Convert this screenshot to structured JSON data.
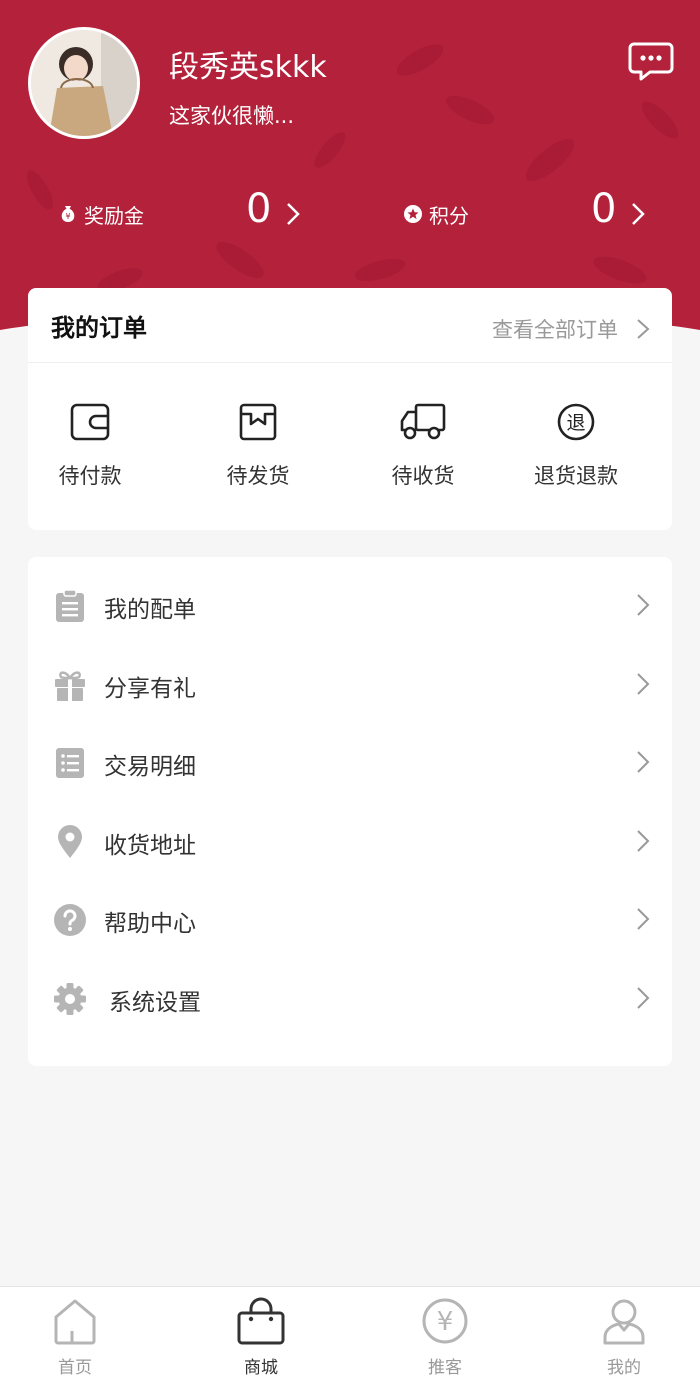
{
  "profile": {
    "username": "段秀英skkk",
    "bio": "这家伙很懒..."
  },
  "stats": {
    "reward_label": "奖励金",
    "reward_value": "0",
    "points_label": "积分",
    "points_value": "0"
  },
  "orders": {
    "title": "我的订单",
    "view_all": "查看全部订单",
    "items": [
      {
        "label": "待付款",
        "icon": "wallet-icon"
      },
      {
        "label": "待发货",
        "icon": "package-icon"
      },
      {
        "label": "待收货",
        "icon": "truck-icon"
      },
      {
        "label": "退货退款",
        "icon": "refund-icon"
      }
    ],
    "refund_glyph": "退"
  },
  "menu": {
    "items": [
      {
        "label": "我的配单",
        "icon": "clipboard-icon"
      },
      {
        "label": "分享有礼",
        "icon": "gift-icon"
      },
      {
        "label": "交易明细",
        "icon": "list-icon"
      },
      {
        "label": "收货地址",
        "icon": "location-pin-icon"
      },
      {
        "label": "帮助中心",
        "icon": "help-icon"
      },
      {
        "label": "系统设置",
        "icon": "gear-icon"
      }
    ]
  },
  "tabbar": {
    "items": [
      {
        "label": "首页",
        "icon": "home-icon"
      },
      {
        "label": "商城",
        "icon": "shopping-bag-icon",
        "active": true
      },
      {
        "label": "推客",
        "icon": "yuan-coin-icon"
      },
      {
        "label": "我的",
        "icon": "user-icon"
      }
    ],
    "yuan_glyph": "¥"
  },
  "colors": {
    "header": "#b3213b",
    "icon_gray": "#b5b5b5",
    "text_dark": "#333333",
    "text_muted": "#999999"
  }
}
